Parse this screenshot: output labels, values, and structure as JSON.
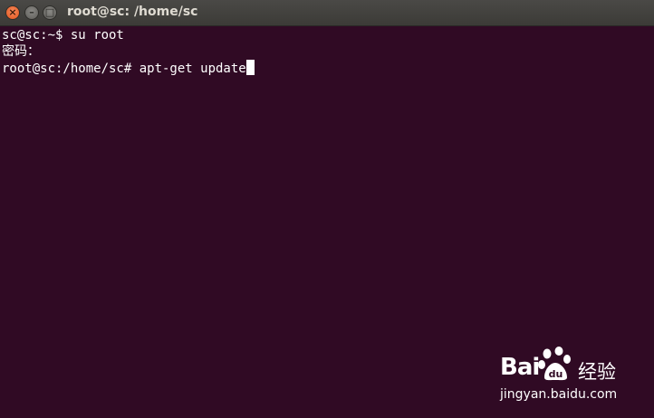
{
  "window": {
    "title": "root@sc: /home/sc",
    "close_glyph": "×",
    "minimize_glyph": "–",
    "maximize_glyph": "□"
  },
  "terminal": {
    "background": "#300a24",
    "foreground": "#ffffff",
    "lines": [
      "sc@sc:~$ su root",
      "密码：",
      "root@sc:/home/sc# apt-get update"
    ]
  },
  "watermark": {
    "brand_left": "Bai",
    "brand_right": "经验",
    "url": "jingyan.baidu.com",
    "icon": "baidu-paw-icon"
  }
}
